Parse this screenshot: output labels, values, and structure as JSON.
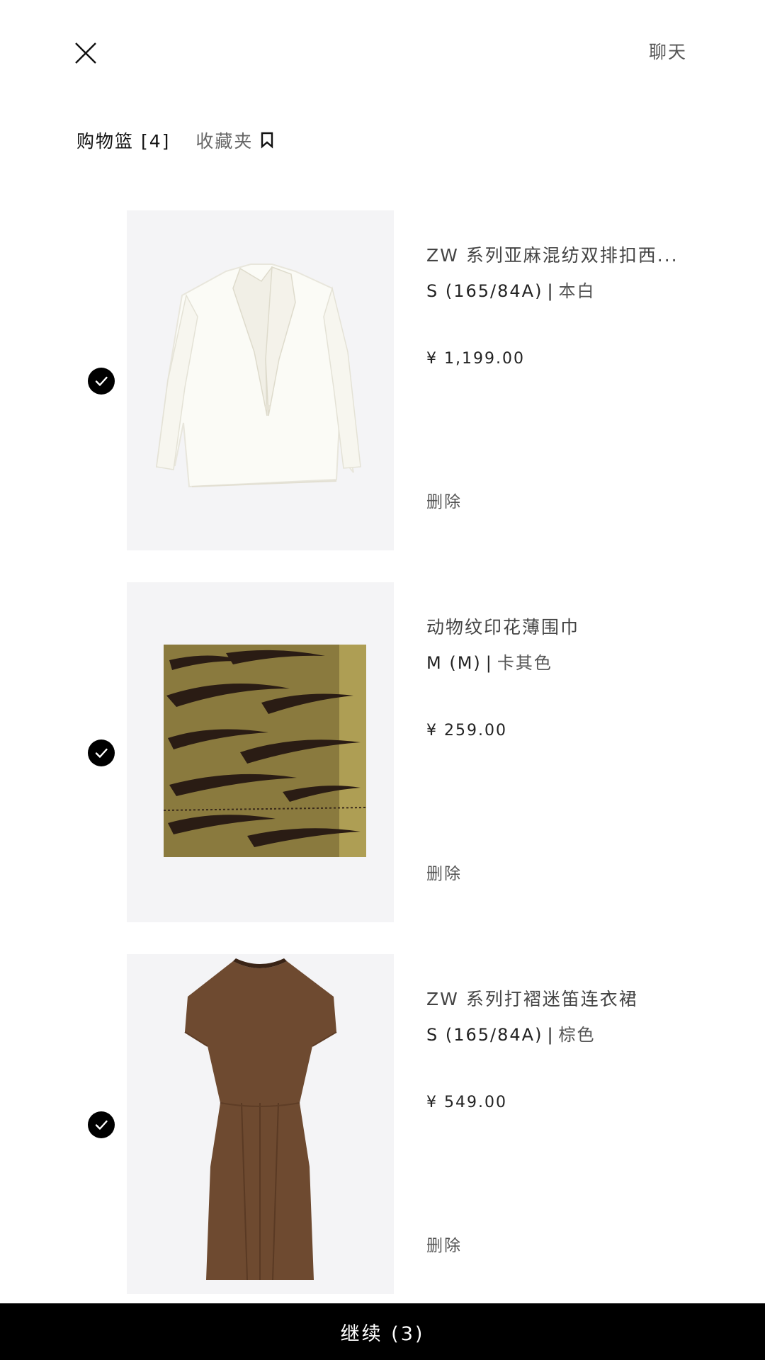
{
  "header": {
    "close_icon": "close-icon",
    "chat_label": "聊天"
  },
  "tabs": {
    "cart_label": "购物篮 [4]",
    "favorites_label": "收藏夹",
    "favorites_icon": "bookmark-icon"
  },
  "items": [
    {
      "name": "ZW 系列亚麻混纺双排扣西...",
      "size": "S (165/84A)",
      "separator": "|",
      "color": "本白",
      "price": "¥ 1,199.00",
      "delete_label": "删除",
      "selected": true,
      "image": "white-linen-blazer"
    },
    {
      "name": "动物纹印花薄围巾",
      "size": "M (M)",
      "separator": "|",
      "color": "卡其色",
      "price": "¥ 259.00",
      "delete_label": "删除",
      "selected": true,
      "image": "tiger-print-scarf"
    },
    {
      "name": "ZW 系列打褶迷笛连衣裙",
      "size": "S (165/84A)",
      "separator": "|",
      "color": "棕色",
      "price": "¥ 549.00",
      "delete_label": "删除",
      "selected": true,
      "image": "brown-midi-dress"
    }
  ],
  "footer": {
    "continue_label": "继续 (3)"
  },
  "colors": {
    "accent": "#000000",
    "photo_bg": "#f4f4f6",
    "text_primary": "#1a1a1a",
    "text_secondary": "#555555"
  }
}
